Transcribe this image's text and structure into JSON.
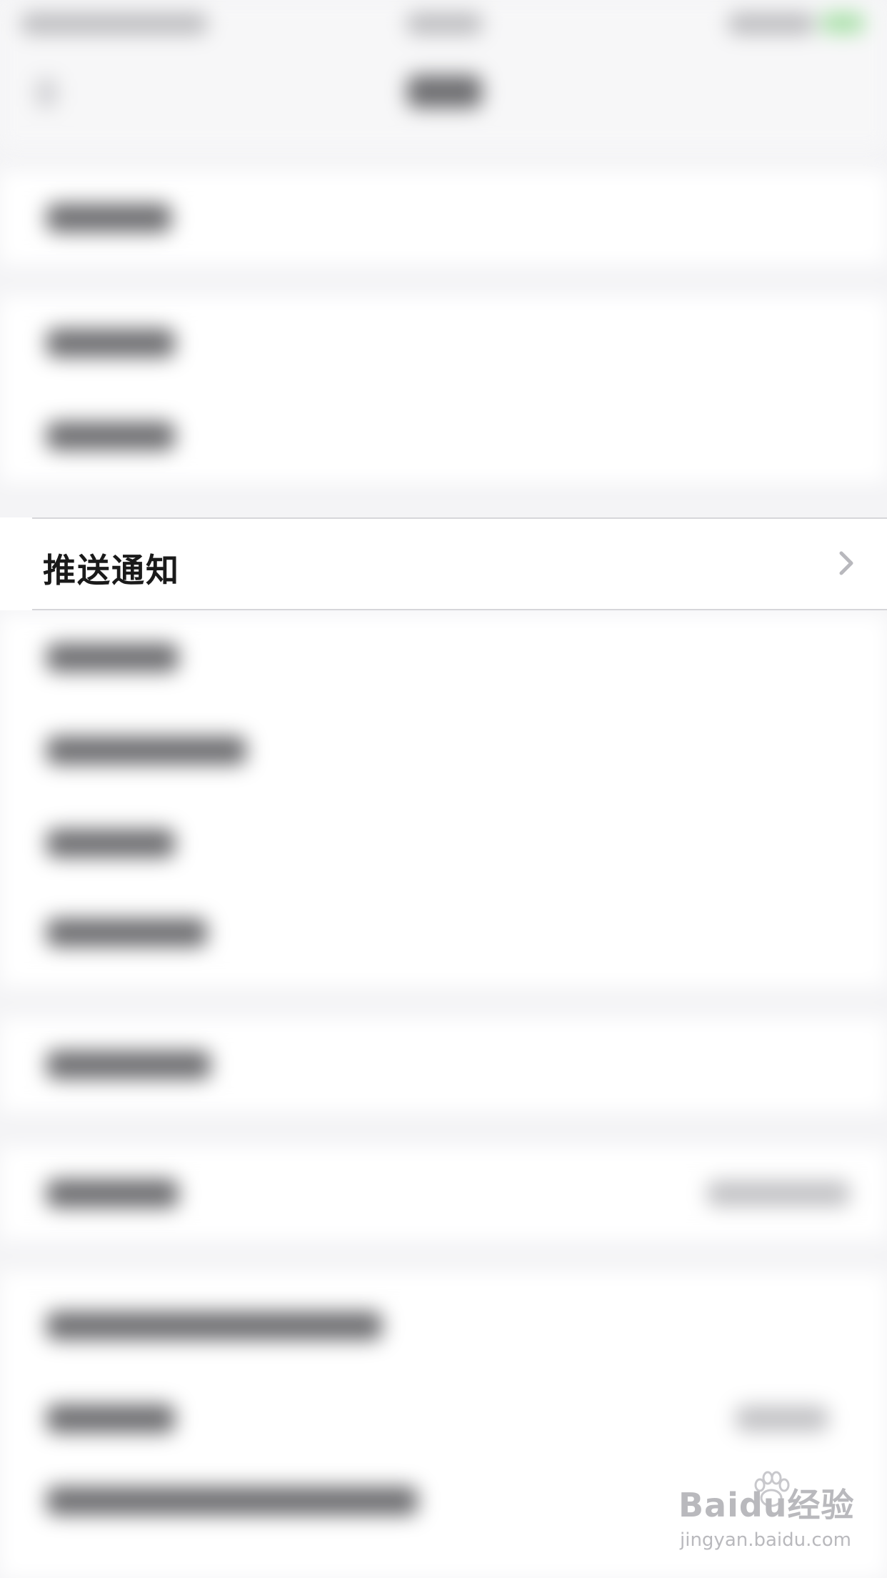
{
  "focus_row": {
    "label": "推送通知",
    "chevron_icon": "chevron-right-icon"
  },
  "watermark": {
    "brand": "Baidu经验",
    "url": "jingyan.baidu.com"
  },
  "colors": {
    "background": "#f4f4f6",
    "row_background": "#ffffff",
    "separator": "#d6d6da",
    "label_text": "#1a1a1a",
    "chevron": "#b8b8bd",
    "watermark": "#b9b9bd"
  }
}
